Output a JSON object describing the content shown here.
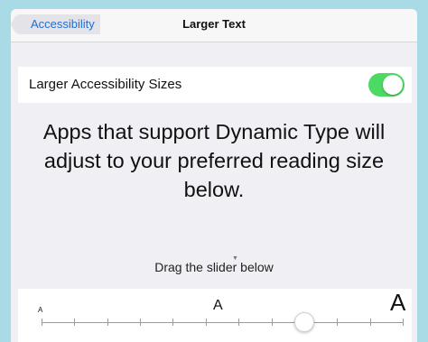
{
  "navbar": {
    "back_label": "Accessibility",
    "title": "Larger Text"
  },
  "toggle": {
    "label": "Larger Accessibility Sizes",
    "on": true,
    "color": "#4cd964"
  },
  "description": "Apps that support Dynamic Type will adjust to your preferred reading size below.",
  "slider": {
    "instruction": "Drag the slider below",
    "small_label": "A",
    "medium_label": "A",
    "large_label": "A",
    "tick_count": 12,
    "selected_index": 8
  }
}
